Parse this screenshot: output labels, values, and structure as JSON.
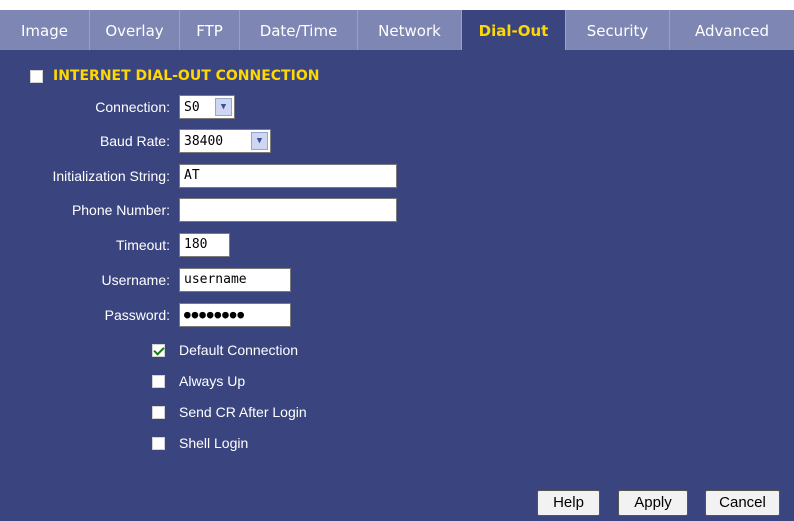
{
  "tabs": [
    "Image",
    "Overlay",
    "FTP",
    "Date/Time",
    "Network",
    "Dial-Out",
    "Security",
    "Advanced"
  ],
  "active_tab": "Dial-Out",
  "section": {
    "title": "INTERNET DIAL-OUT CONNECTION",
    "checked": false
  },
  "form": {
    "connection": {
      "label": "Connection:",
      "value": "S0"
    },
    "baud_rate": {
      "label": "Baud Rate:",
      "value": "38400"
    },
    "init_string": {
      "label": "Initialization String:",
      "value": "AT"
    },
    "phone_number": {
      "label": "Phone Number:",
      "value": ""
    },
    "timeout": {
      "label": "Timeout:",
      "value": "180"
    },
    "username": {
      "label": "Username:",
      "value": "username"
    },
    "password": {
      "label": "Password:",
      "value": "●●●●●●●●"
    }
  },
  "options": [
    {
      "label": "Default Connection",
      "checked": true
    },
    {
      "label": "Always Up",
      "checked": false
    },
    {
      "label": "Send CR After Login",
      "checked": false
    },
    {
      "label": "Shell Login",
      "checked": false
    }
  ],
  "buttons": {
    "help": "Help",
    "apply": "Apply",
    "cancel": "Cancel"
  },
  "colors": {
    "background": "#3a4580",
    "tab": "#7e87b3",
    "active_tab_text": "#ffd800",
    "section_title": "#ffd800"
  }
}
